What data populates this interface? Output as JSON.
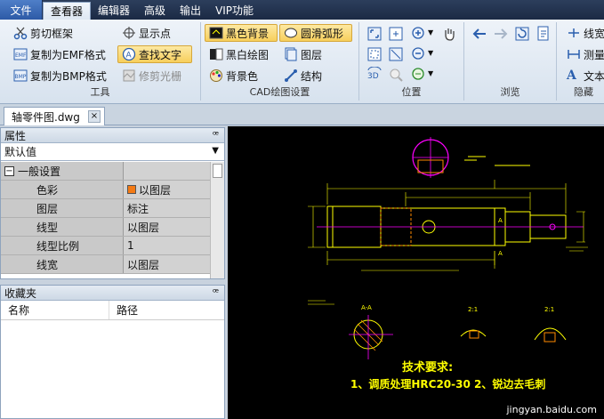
{
  "menubar": {
    "file": "文件",
    "tabs": [
      "查看器",
      "编辑器",
      "高级",
      "输出",
      "VIP功能"
    ],
    "active_index": 0
  },
  "ribbon": {
    "tools": {
      "label": "工具",
      "cut_frame": "剪切框架",
      "copy_emf": "复制为EMF格式",
      "copy_bmp": "复制为BMP格式",
      "show_point": "显示点",
      "find_text": "查找文字",
      "trim_raster": "修剪光栅"
    },
    "cad": {
      "label": "CAD绘图设置",
      "black_bg": "黑色背景",
      "bw_draw": "黑白绘图",
      "bg_color": "背景色",
      "smooth_arc": "圆滑弧形",
      "layers": "图层",
      "structure": "结构"
    },
    "position": {
      "label": "位置"
    },
    "browse": {
      "label": "浏览"
    },
    "hide": {
      "label": "隐藏",
      "linewidth": "线宽",
      "measure": "测量",
      "text": "文本"
    }
  },
  "document_tab": {
    "name": "轴零件图.dwg",
    "close": "×"
  },
  "properties": {
    "title": "属性",
    "pin": "ꟹ",
    "dropdown": "默认值",
    "group": "一般设置",
    "rows": [
      {
        "key": "色彩",
        "value": "以图层",
        "swatch": "#f47a14"
      },
      {
        "key": "图层",
        "value": "标注"
      },
      {
        "key": "线型",
        "value": "以图层"
      },
      {
        "key": "线型比例",
        "value": "1"
      },
      {
        "key": "线宽",
        "value": "以图层"
      }
    ]
  },
  "favorites": {
    "title": "收藏夹",
    "col_name": "名称",
    "col_path": "路径"
  },
  "drawing": {
    "note_title": "技术要求:",
    "note_line": "1、调质处理HRC20-30   2、锐边去毛刺",
    "section_label": "A-A",
    "label_a1": "A",
    "label_a2": "A",
    "scale_1": "2:1",
    "scale_2": "2:1"
  },
  "watermark": "jingyan.baidu.com",
  "colors": {
    "accent": "#2d5aa6",
    "cad_yellow": "#ffff00",
    "cad_magenta": "#ff00ff",
    "cad_green": "#00ff00"
  }
}
